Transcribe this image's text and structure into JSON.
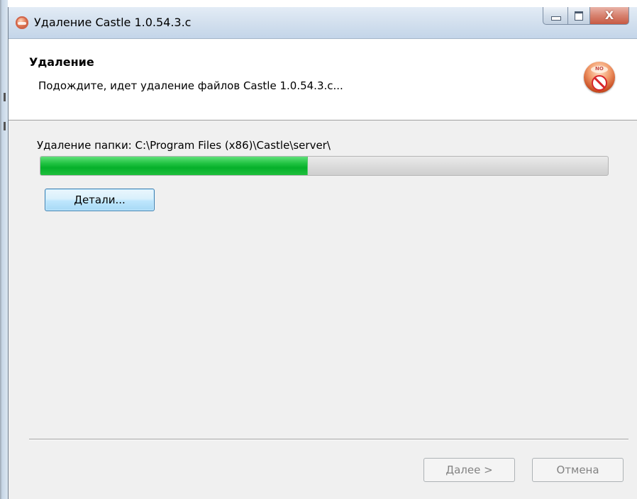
{
  "window": {
    "title": "Удаление Castle 1.0.54.3.c",
    "app_icon": "castle-app-icon",
    "caption_buttons": {
      "minimize": "minimize-icon",
      "maximize": "maximize-icon",
      "close_glyph": "X"
    }
  },
  "header": {
    "title": "Удаление",
    "subtitle": "Подождите, идет удаление файлов Castle 1.0.54.3.c...",
    "icon": "uninstall-disc-icon"
  },
  "progress": {
    "status_text": "Удаление папки: C:\\Program Files (x86)\\Castle\\server\\",
    "percent": 47,
    "fill_color": "#06b02a"
  },
  "buttons": {
    "details": "Детали...",
    "next": "Далее >",
    "cancel": "Отмена"
  }
}
